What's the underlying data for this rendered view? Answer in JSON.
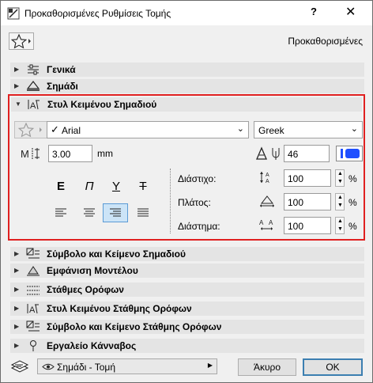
{
  "window": {
    "title": "Προκαθορισμένες Ρυθμίσεις Τομής",
    "help_label": "?",
    "close_icon": "close-icon"
  },
  "favorites": {
    "preset_label": "Προκαθορισμένες"
  },
  "sections": {
    "general": "Γενικά",
    "marker": "Σημάδι",
    "marker_text_style": "Στυλ Κειμένου Σημαδιού",
    "marker_symbol_text": "Σύμβολο και Κείμενο Σημαδιού",
    "model_display": "Εμφάνιση Μοντέλου",
    "story_levels": "Στάθμες Ορόφων",
    "story_level_text_style": "Στυλ Κειμένου Στάθμης Ορόφων",
    "story_level_symbol_text": "Σύμβολο και Κείμενο Στάθμης Ορόφων",
    "grid_tool": "Εργαλείο Κάνναβος"
  },
  "text_style": {
    "font": "Arial",
    "script": "Greek",
    "text_size": "3.00",
    "text_size_unit": "mm",
    "pen": "46",
    "style_bold": "E",
    "style_italic": "Π",
    "style_underline": "Y",
    "style_strikethrough": "T",
    "leading_label": "Διάστιχο:",
    "leading_value": "100",
    "width_label": "Πλάτος:",
    "width_value": "100",
    "spacing_label": "Διάστημα:",
    "spacing_value": "100",
    "percent": "%",
    "selected_alignment": "right",
    "pen_color": "#1f4fff"
  },
  "footer": {
    "layer_dropdown": "Σημάδι - Τομή",
    "cancel_label": "Άκυρο",
    "ok_label": "OK"
  }
}
